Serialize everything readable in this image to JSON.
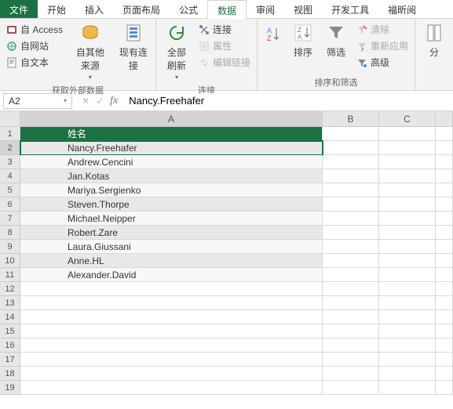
{
  "tabs": [
    "文件",
    "开始",
    "插入",
    "页面布局",
    "公式",
    "数据",
    "审阅",
    "视图",
    "开发工具",
    "福昕阅"
  ],
  "active_tab": 5,
  "ribbon": {
    "group1": {
      "label": "获取外部数据",
      "items": [
        "自 Access",
        "自网站",
        "自文本"
      ],
      "other_sources": "自其他来源",
      "existing_conn": "现有连接"
    },
    "group2": {
      "label": "连接",
      "refresh_all": "全部刷新",
      "items": [
        "连接",
        "属性",
        "编辑链接"
      ]
    },
    "group3": {
      "label": "排序和筛选",
      "sort": "排序",
      "filter": "筛选",
      "items": [
        "清除",
        "重新应用",
        "高级"
      ]
    },
    "group4": {
      "split": "分"
    }
  },
  "namebox": "A2",
  "formula": "Nancy.Freehafer",
  "columns": [
    "A",
    "B",
    "C"
  ],
  "selected_cell": {
    "row": 2,
    "col": "A"
  },
  "table_header": "姓名",
  "rows": [
    "Nancy.Freehafer",
    "Andrew.Cencini",
    "Jan.Kotas",
    "Mariya.Sergienko",
    "Steven.Thorpe",
    "Michael.Neipper",
    "Robert.Zare",
    "Laura.Giussani",
    "Anne.HL",
    "Alexander.David"
  ],
  "total_rows": 19,
  "chart_data": {
    "type": "table",
    "title": "姓名",
    "categories": [
      "姓名"
    ],
    "values": [
      "Nancy.Freehafer",
      "Andrew.Cencini",
      "Jan.Kotas",
      "Mariya.Sergienko",
      "Steven.Thorpe",
      "Michael.Neipper",
      "Robert.Zare",
      "Laura.Giussani",
      "Anne.HL",
      "Alexander.David"
    ]
  }
}
